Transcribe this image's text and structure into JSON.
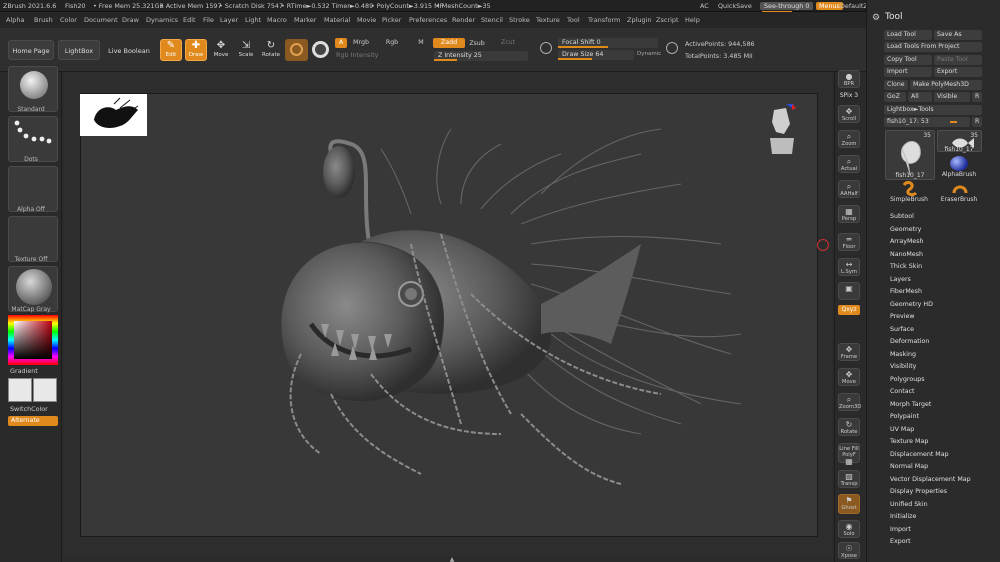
{
  "menubar": {
    "app_info": "ZBrush 2021.6.6",
    "doc": "Fish20",
    "stats": [
      "• Free Mem 25.321GB",
      "• Active Mem 1597",
      "• Scratch Disk 7547",
      "• RTime►0.532 Timer►0.489",
      "• PolyCount►3.915 MP",
      "• MeshCount►35"
    ],
    "ac": "AC",
    "quicksave": "QuickSave",
    "seethrough": "See-through  0",
    "menus": "Menus",
    "script": "DefaultZScript"
  },
  "mainmenus": [
    "Alpha",
    "Brush",
    "Color",
    "Document",
    "Draw",
    "Dynamics",
    "Edit",
    "File",
    "Layer",
    "Light",
    "Macro",
    "Marker",
    "Material",
    "Movie",
    "Picker",
    "Preferences",
    "Render",
    "Stencil",
    "Stroke",
    "Texture",
    "Tool",
    "Transform",
    "Zplugin",
    "Zscript",
    "Help"
  ],
  "shelf": {
    "home": "Home Page",
    "lightbox": "LightBox",
    "live_boolean": "Live Boolean",
    "edit": "Edit",
    "draw": "Draw",
    "move": "Move",
    "scale": "Scale",
    "rotate": "Rotate",
    "a": "A",
    "mrgb": "Mrgb",
    "rgb": "Rgb",
    "m": "M",
    "zadd": "Zadd",
    "zsub": "Zsub",
    "zcut": "Zcut",
    "rgb_intensity": "Rgb Intensity",
    "z_intensity": "Z Intensity 25",
    "focal_shift": "Focal Shift 0",
    "draw_size": "Draw Size 64",
    "dynamic": "Dynamic",
    "active_points": "ActivePoints: 944,586",
    "total_points": "TotalPoints: 3.485 Mil"
  },
  "lefttray": {
    "brush": "Standard",
    "stroke": "Dots",
    "alpha": "Alpha Off",
    "texture": "Texture Off",
    "material": "MatCap Gray",
    "gradient": "Gradient",
    "switchcolor": "SwitchColor",
    "alternate": "Alternate"
  },
  "righttray": [
    {
      "name": "bpr",
      "label": "BPR",
      "glyph": "●"
    },
    {
      "name": "spix",
      "label": "SPix 3",
      "glyph": ""
    },
    {
      "name": "scroll",
      "label": "Scroll",
      "glyph": "✥"
    },
    {
      "name": "zoom",
      "label": "Zoom",
      "glyph": "⌕"
    },
    {
      "name": "actual",
      "label": "Actual",
      "glyph": "⌕"
    },
    {
      "name": "aahalf",
      "label": "AAHalf",
      "glyph": "⌕"
    },
    {
      "name": "persp",
      "label": "Persp",
      "glyph": "▦"
    },
    {
      "name": "floor",
      "label": "Floor",
      "glyph": "═"
    },
    {
      "name": "lsym",
      "label": "L.Sym",
      "glyph": "↔"
    },
    {
      "name": "lock",
      "label": "",
      "glyph": "▣"
    },
    {
      "name": "qxyz",
      "label": "Qxyz",
      "glyph": ""
    },
    {
      "name": "frame",
      "label": "Frame",
      "glyph": "✥"
    },
    {
      "name": "move",
      "label": "Move",
      "glyph": "✥"
    },
    {
      "name": "zoom3d",
      "label": "Zoom3D",
      "glyph": "⌕"
    },
    {
      "name": "rotate",
      "label": "Rotate",
      "glyph": "↻"
    },
    {
      "name": "linefill",
      "label": "Line Fill PolyF",
      "glyph": "▦"
    },
    {
      "name": "transp",
      "label": "Transp",
      "glyph": "▧"
    },
    {
      "name": "ghost",
      "label": "Ghost",
      "glyph": "⚑"
    },
    {
      "name": "solo",
      "label": "Solo",
      "glyph": "◉"
    },
    {
      "name": "xpose",
      "label": "Xpose",
      "glyph": "☉"
    }
  ],
  "tool": {
    "title": "Tool",
    "load_tool": "Load Tool",
    "save_as": "Save As",
    "load_from_project": "Load Tools From Project",
    "copy_tool": "Copy Tool",
    "paste_tool": "Paste Tool",
    "import": "Import",
    "export": "Export",
    "clone": "Clone",
    "make_polymesh": "Make PolyMesh3D",
    "goz": "GoZ",
    "all": "All",
    "visible": "Visible",
    "r": "R",
    "lightbox_tools": "Lightbox►Tools",
    "current_tool": "fish10_17: 53",
    "count_badge_1": "35",
    "count_badge_2": "35",
    "thumb1": "fish10_17",
    "thumb2": "fish10_17",
    "alphabrush": "AlphaBrush",
    "simplebrush": "SimpleBrush",
    "eraserbrush": "EraserBrush",
    "submenus": [
      "Subtool",
      "Geometry",
      "ArrayMesh",
      "NanoMesh",
      "Thick Skin",
      "Layers",
      "FiberMesh",
      "Geometry HD",
      "Preview",
      "Surface",
      "Deformation",
      "Masking",
      "Visibility",
      "Polygroups",
      "Contact",
      "Morph Target",
      "Polypaint",
      "UV Map",
      "Texture Map",
      "Displacement Map",
      "Normal Map",
      "Vector Displacement Map",
      "Display Properties",
      "Unified Skin",
      "Initialize",
      "Import",
      "Export"
    ]
  },
  "colors": {
    "accent": "#e08a1e",
    "background": "#2b2b2b",
    "canvas": "#383838"
  }
}
